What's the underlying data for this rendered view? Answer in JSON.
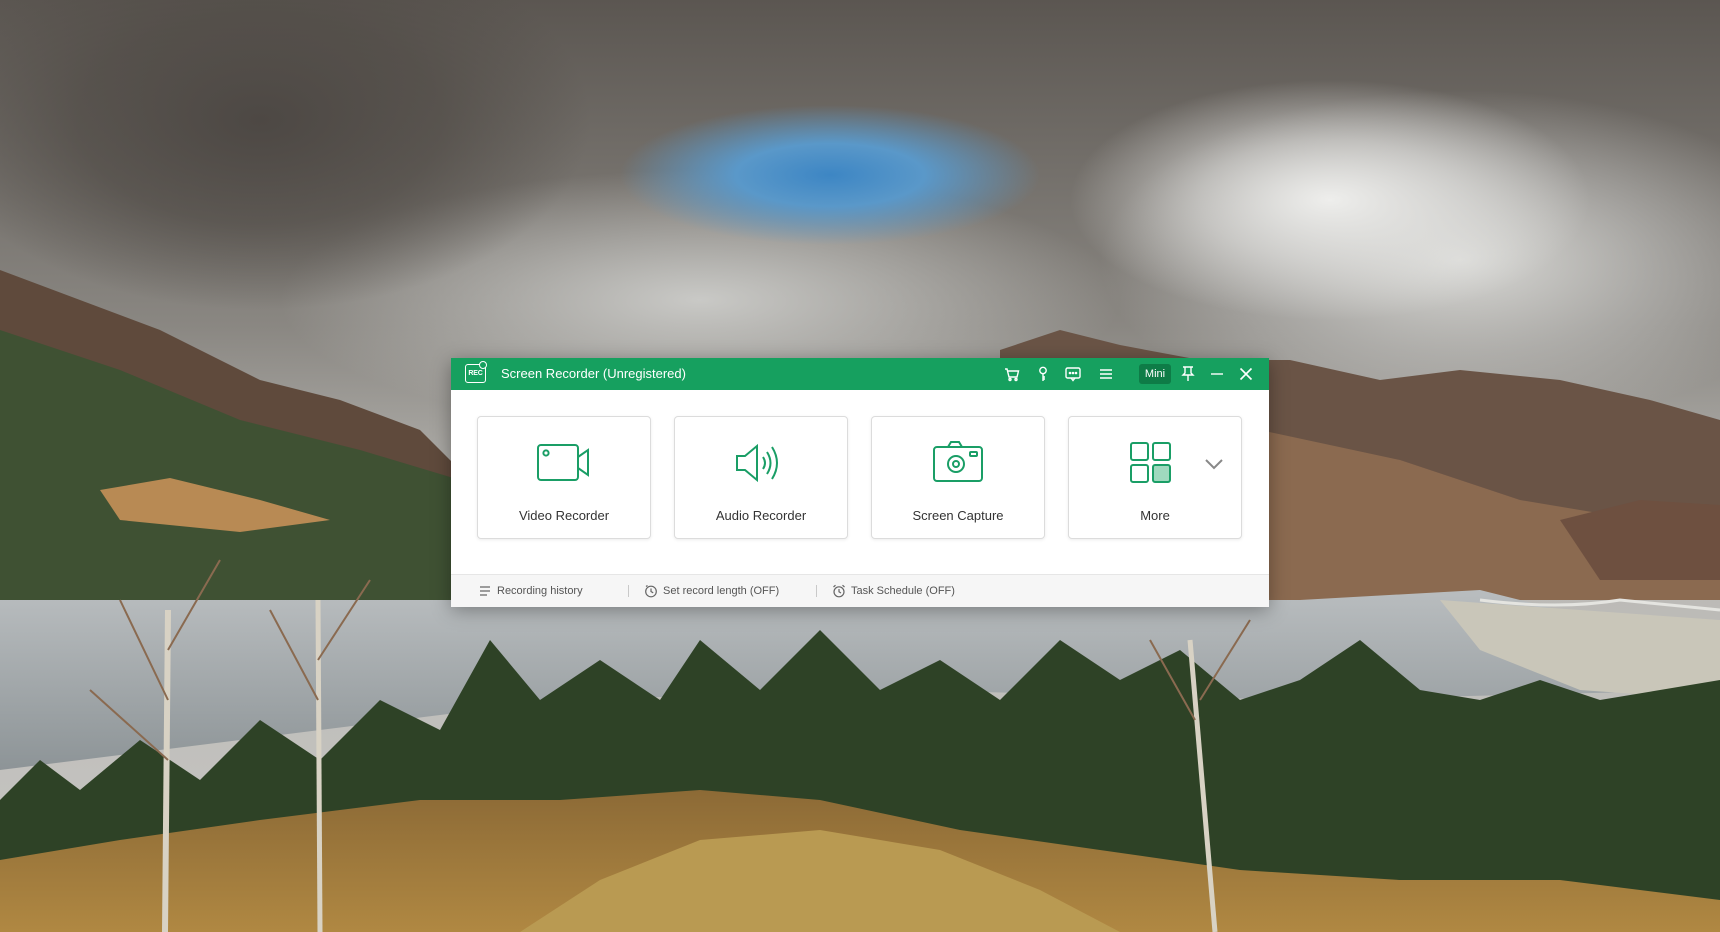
{
  "app": {
    "logo_text": "REC",
    "title": "Screen Recorder (Unregistered)",
    "mini_label": "Mini",
    "accent_color": "#16a05f",
    "icon_color": "#1a9e66"
  },
  "titlebar_icons": [
    "cart-icon",
    "key-icon",
    "feedback-icon",
    "menu-icon",
    "pin-icon",
    "minimize-icon",
    "close-icon"
  ],
  "modes": [
    {
      "label": "Video Recorder",
      "icon": "video-camera-icon"
    },
    {
      "label": "Audio Recorder",
      "icon": "speaker-icon"
    },
    {
      "label": "Screen Capture",
      "icon": "camera-icon"
    },
    {
      "label": "More",
      "icon": "grid-icon"
    }
  ],
  "footer": {
    "history": "Recording history",
    "record_length": "Set record length (OFF)",
    "task_schedule": "Task Schedule (OFF)"
  }
}
